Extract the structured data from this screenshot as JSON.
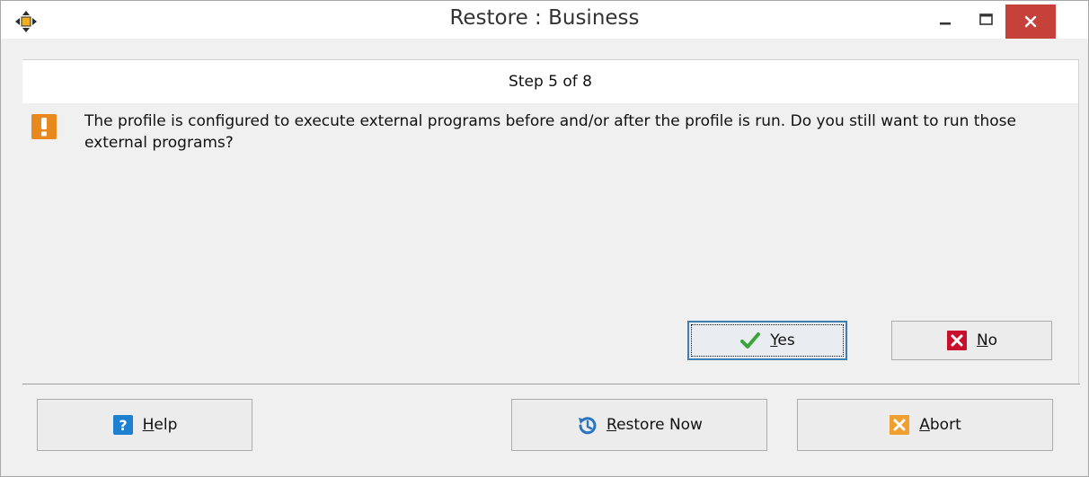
{
  "window": {
    "title": "Restore : Business",
    "app_icon": "move-arrows-icon",
    "controls": {
      "minimize": "minimize-icon",
      "maximize": "maximize-icon",
      "close": "close-icon"
    }
  },
  "wizard": {
    "step_label": "Step 5 of 8"
  },
  "prompt": {
    "icon": "warning-exclamation-icon",
    "message": "The profile is configured to execute external programs before and/or after the profile is run. Do you still want to run those external programs?",
    "yes_button": {
      "accel": "Y",
      "rest": "es",
      "icon": "checkmark-icon"
    },
    "no_button": {
      "accel": "N",
      "rest": "o",
      "icon": "red-x-icon"
    }
  },
  "footer": {
    "help_button": {
      "accel": "H",
      "rest": "elp",
      "icon": "help-question-icon"
    },
    "restore_button": {
      "accel": "R",
      "rest": "estore Now",
      "icon": "clock-history-icon"
    },
    "abort_button": {
      "accel": "A",
      "rest": "bort",
      "icon": "orange-x-icon"
    }
  },
  "colors": {
    "close_button": "#c7413b",
    "warning": "#e8891d",
    "checkmark": "#3aa33a",
    "no_x": "#c8102e",
    "help_blue": "#1f7fd1",
    "abort_orange": "#f0a030"
  }
}
